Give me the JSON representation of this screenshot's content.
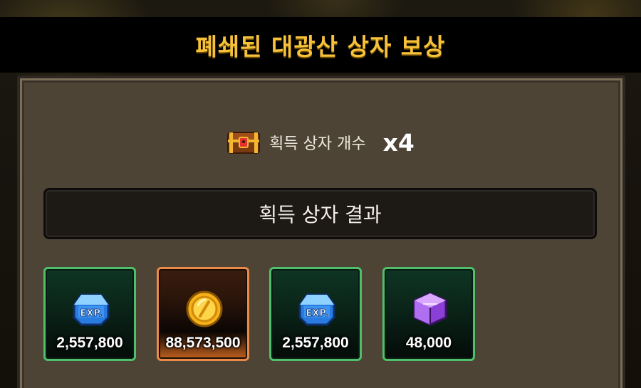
{
  "title": "폐쇄된 대광산 상자 보상",
  "box_count": {
    "label": "획득 상자 개수",
    "value": "x4",
    "icon": "treasure-chest-icon"
  },
  "result_header": "획득 상자 결과",
  "rewards": [
    {
      "icon": "exp-crystal-icon",
      "value": "2,557,800",
      "rarity_color": "#4fbf6b"
    },
    {
      "icon": "gold-coin-icon",
      "value": "88,573,500",
      "rarity_color": "#e98b46"
    },
    {
      "icon": "exp-crystal-icon",
      "value": "2,557,800",
      "rarity_color": "#4fbf6b"
    },
    {
      "icon": "purple-cube-icon",
      "value": "48,000",
      "rarity_color": "#4fbf6b"
    }
  ]
}
